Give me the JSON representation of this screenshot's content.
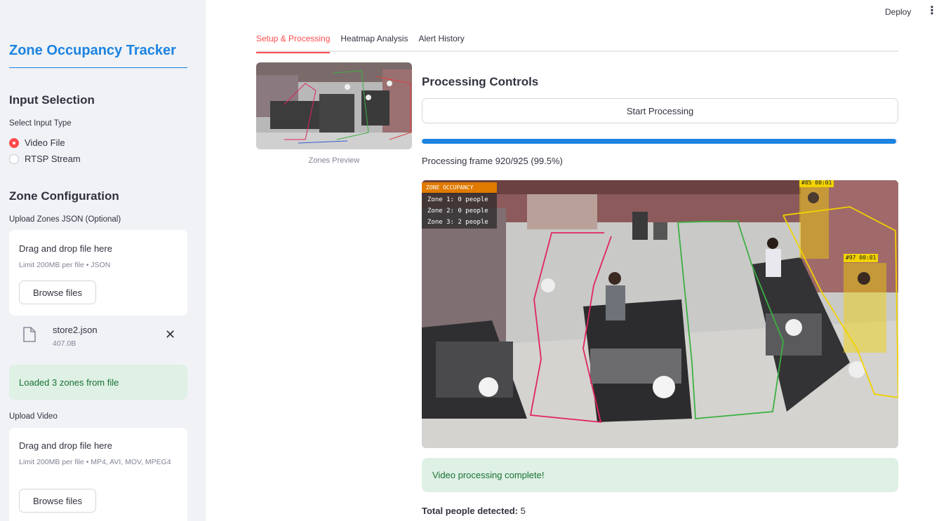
{
  "header": {
    "deploy_label": "Deploy",
    "menu_icon": "kebab-menu-icon"
  },
  "sidebar": {
    "title": "Zone Occupancy Tracker",
    "input_section": {
      "heading": "Input Selection",
      "label": "Select Input Type",
      "options": [
        {
          "label": "Video File",
          "selected": true
        },
        {
          "label": "RTSP Stream",
          "selected": false
        }
      ]
    },
    "zone_section": {
      "heading": "Zone Configuration",
      "upload_zones_label": "Upload Zones JSON (Optional)",
      "zones_dropzone": {
        "title": "Drag and drop file here",
        "limit": "Limit 200MB per file • JSON",
        "browse_label": "Browse files"
      },
      "uploaded_file": {
        "name": "store2.json",
        "size": "407.0B"
      },
      "success_message": "Loaded 3 zones from file"
    },
    "video_section": {
      "label": "Upload Video",
      "dropzone": {
        "title": "Drag and drop file here",
        "limit": "Limit 200MB per file • MP4, AVI, MOV, MPEG4",
        "browse_label": "Browse files"
      }
    }
  },
  "tabs": [
    {
      "label": "Setup & Processing",
      "active": true
    },
    {
      "label": "Heatmap Analysis",
      "active": false
    },
    {
      "label": "Alert History",
      "active": false
    }
  ],
  "preview": {
    "caption": "Zones Preview"
  },
  "controls": {
    "heading": "Processing Controls",
    "start_label": "Start Processing",
    "progress_fraction": 0.995,
    "progress_text": "Processing frame 920/925 (99.5%)"
  },
  "frame": {
    "overlay_title": "ZONE OCCUPANCY",
    "zone_lines": [
      "Zone 1: 0 people",
      "Zone 2: 0 people",
      "Zone 3: 2 people"
    ],
    "tracks": [
      "#85 00:01",
      "#97 00:01"
    ],
    "colors": {
      "zone1": "#e0245e",
      "zone2": "#3cb043",
      "zone3": "#f2d200"
    }
  },
  "result": {
    "complete_message": "Video processing complete!",
    "total_label": "Total people detected:",
    "total_value": "5"
  },
  "colors": {
    "accent": "#1c83e1",
    "tab_active": "#ff4b4b",
    "success_bg": "#dff0e5",
    "success_text": "#177233"
  }
}
